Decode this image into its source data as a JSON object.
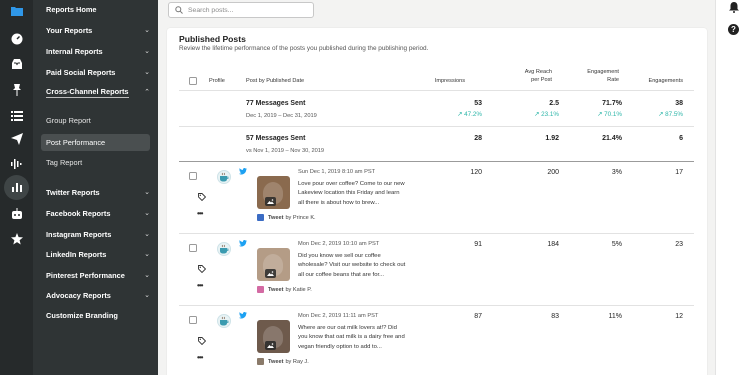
{
  "rail": {
    "icons": [
      "folder-icon",
      "gauge-icon",
      "inbox-icon",
      "pin-icon",
      "list-icon",
      "send-icon",
      "waveform-icon",
      "reports-icon",
      "bot-icon",
      "star-icon"
    ]
  },
  "nav": {
    "items": [
      {
        "label": "Reports Home",
        "chevron": ""
      },
      {
        "label": "Your Reports",
        "chevron": "⌄"
      },
      {
        "label": "Internal Reports",
        "chevron": "⌄"
      },
      {
        "label": "Paid Social Reports",
        "chevron": "⌄"
      },
      {
        "label": "Cross-Channel Reports",
        "chevron": "⌃"
      }
    ],
    "sub_items": [
      "Group Report",
      "Post Performance",
      "Tag Report"
    ],
    "lower_items": [
      {
        "label": "Twitter Reports",
        "chevron": "⌄"
      },
      {
        "label": "Facebook Reports",
        "chevron": "⌄"
      },
      {
        "label": "Instagram Reports",
        "chevron": "⌄"
      },
      {
        "label": "LinkedIn Reports",
        "chevron": "⌄"
      },
      {
        "label": "Pinterest Performance",
        "chevron": "⌄"
      },
      {
        "label": "Advocacy Reports",
        "chevron": "⌄"
      },
      {
        "label": "Customize Branding",
        "chevron": ""
      }
    ]
  },
  "search": {
    "placeholder": "Search posts..."
  },
  "card": {
    "title": "Published Posts",
    "subtitle": "Review the lifetime performance of the posts you published during the publishing period."
  },
  "table": {
    "headers": {
      "profile": "Profile",
      "post": "Post by Published Date",
      "impressions": "Impressions",
      "reach_line1": "Avg Reach",
      "reach_line2": "per Post",
      "eng_rate_line1": "Engagement",
      "eng_rate_line2": "Rate",
      "engagements": "Engagements"
    },
    "summary": [
      {
        "title": "77 Messages Sent",
        "date": "Dec 1, 2019 – Dec 31, 2019",
        "impressions": "53",
        "reach": "2.5",
        "rate": "71.7%",
        "engagements": "38",
        "d_impressions": "↗ 47.2%",
        "d_reach": "↗ 23.1%",
        "d_rate": "↗ 70.1%",
        "d_engagements": "↗ 87.5%"
      },
      {
        "title": "57 Messages Sent",
        "date": "vs Nov 1, 2019 – Nov 30, 2019",
        "impressions": "28",
        "reach": "1.92",
        "rate": "21.4%",
        "engagements": "6"
      }
    ],
    "posts": [
      {
        "date": "Sun Dec 1, 2019 8:10 am PST",
        "text": "Love pour over coffee? Come to our new Lakeview location this Friday and learn all there is about how to brew...",
        "by_prefix": "Tweet",
        "by_word": "by",
        "author": "Prince K.",
        "impressions": "120",
        "reach": "200",
        "rate": "3%",
        "engagements": "17",
        "thumb_color": "#8a6a4e"
      },
      {
        "date": "Mon Dec 2, 2019 10:10 am PST",
        "text": "Did you know we sell our coffee wholesale? Visit our website to check out all our coffee beans that are for...",
        "by_prefix": "Tweet",
        "by_word": "by",
        "author": "Katie P.",
        "impressions": "91",
        "reach": "184",
        "rate": "5%",
        "engagements": "23",
        "thumb_color": "#b49c86"
      },
      {
        "date": "Mon Dec 2, 2019 11:11 am PST",
        "text": "Where are our oat milk lovers at!? Did you know that oat milk is a dairy free and vegan friendly option to add to...",
        "by_prefix": "Tweet",
        "by_word": "by",
        "author": "Ray J.",
        "impressions": "87",
        "reach": "83",
        "rate": "11%",
        "engagements": "12",
        "thumb_color": "#6e5a4c"
      }
    ]
  },
  "right_rail": {
    "icons": [
      "bell-icon",
      "help-icon"
    ],
    "help_glyph": "?"
  },
  "colors": {
    "accent": "#2bb5a8",
    "rail": "#262a2b",
    "nav": "#2f3435",
    "twitter": "#1da1f2"
  }
}
